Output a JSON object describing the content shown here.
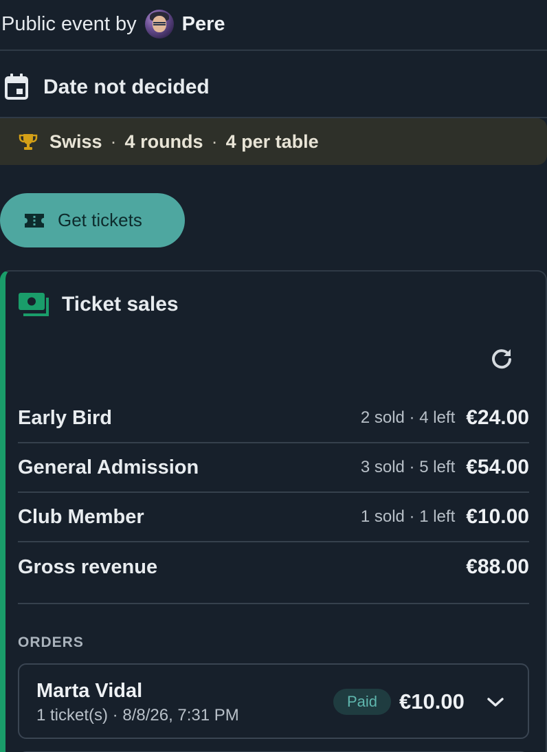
{
  "host": {
    "prefix": "Public event by",
    "name": "Pere"
  },
  "date": {
    "text": "Date not decided",
    "icon": "calendar-icon"
  },
  "format": {
    "icon": "trophy-icon",
    "system": "Swiss",
    "rounds": "4 rounds",
    "per_table": "4 per table",
    "separator": "·",
    "accent_color": "#d4a017"
  },
  "get_tickets": {
    "label": "Get tickets",
    "icon": "ticket-icon",
    "color": "#4ea7a0"
  },
  "sales": {
    "title": "Ticket sales",
    "icon": "money-icon",
    "refresh_icon": "refresh-icon",
    "accent_color": "#1a9d6a",
    "tiers": [
      {
        "name": "Early Bird",
        "meta": "2 sold · 4 left",
        "price": "€24.00"
      },
      {
        "name": "General Admission",
        "meta": "3 sold · 5 left",
        "price": "€54.00"
      },
      {
        "name": "Club Member",
        "meta": "1 sold · 1 left",
        "price": "€10.00"
      }
    ],
    "gross": {
      "label": "Gross revenue",
      "value": "€88.00"
    }
  },
  "orders": {
    "label": "ORDERS",
    "items": [
      {
        "name": "Marta Vidal",
        "sub": "1 ticket(s) · 8/8/26, 7:31 PM",
        "status": "Paid",
        "amount": "€10.00",
        "expand_icon": "chevron-down-icon"
      }
    ]
  }
}
